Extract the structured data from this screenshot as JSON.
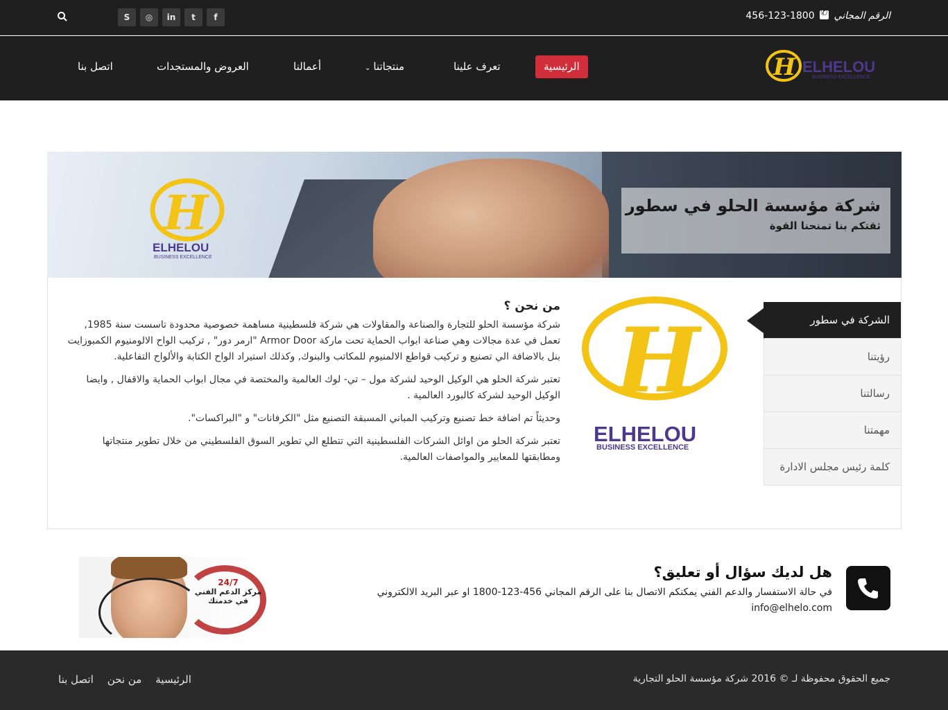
{
  "topbar": {
    "phone_label": "الرقم المجاني",
    "phone_number": "1800-123-456",
    "social_icons": [
      "facebook-icon",
      "twitter-icon",
      "linkedin-icon",
      "dribbble-icon",
      "skype-icon"
    ],
    "social_glyphs": [
      "f",
      "t",
      "in",
      "◎",
      "S"
    ]
  },
  "brand": {
    "name": "ELHELOU",
    "tagline": "BUSINESS EXCELLENCE",
    "logo_gold": "#f3c316",
    "logo_purple": "#4b3a8c"
  },
  "nav": {
    "items": [
      {
        "label": "الرئيسية",
        "active": true
      },
      {
        "label": "تعرف علينا"
      },
      {
        "label": "منتجاتنا",
        "has_dropdown": true
      },
      {
        "label": "أعمالنا"
      },
      {
        "label": "العروض والمستجدات"
      },
      {
        "label": "اتصل بنا"
      }
    ],
    "active_color": "#d12e3b"
  },
  "banner": {
    "title": "شركة مؤسسة الحلو في سطور",
    "subtitle": "ثقتكم بنا تمنحنا القوة"
  },
  "about": {
    "heading": "من نحن ؟",
    "paragraphs": [
      "شركة مؤسسة الحلو للتجارة والصناعة والمقاولات هي شركة فلسطينية مساهمة خصوصية محدودة تاسست سنة 1985, تعمل في عدة مجالات وهي صناعة ابواب الحماية تحت ماركة Armor Door \"ارمر دور\" , تركيب الواح الالومنيوم الكمبوزايت بنل بالاضافة الي تصنيع و تركيب قواطع الالمنيوم للمكاتب والبنوك, وكذلك استيراد الواح الكتابة والألواح التفاعلية.",
      "تعتبر شركة الحلو هي الوكيل الوحيد لشركة مول – تي- لوك العالمية والمختصة في مجال ابواب الحماية والاقفال , وايضا الوكيل الوحيد لشركة كالبورد العالمية .",
      "وحديثاً تم اضافة خط تصنيع وتركيب المباني المسبقة التصنيع مثل \"الكرفانات\" و \"البراكسات\".",
      "تعتبر شركة الحلو من اوائل الشركات الفلسطينية التي تتطلع الي تطوير السوق الفلسطيني من خلال تطوير منتجاتها ومطابقتها للمعايير والمواصفات العالمية."
    ]
  },
  "side_menu": {
    "items": [
      {
        "label": "الشركة في سطور",
        "active": true
      },
      {
        "label": "رؤيتنا"
      },
      {
        "label": "رسالتنا"
      },
      {
        "label": "مهمتنا"
      },
      {
        "label": "كلمة رئيس مجلس الادارة"
      }
    ]
  },
  "cta": {
    "title": "هل لديك سؤال أو تعليق؟",
    "text": "في حالة الاستفسار والدعم الفني يمكنكم الاتصال بنا على الرقم المجاني 456-123-1800 او عبر البريد الالكتروني info@elhelo.com",
    "icon": "phone-icon"
  },
  "support_banner": {
    "badge": "24/7",
    "line1": "مركز الدعم الفني",
    "line2": "في خدمتك"
  },
  "footer": {
    "copyright": "جميع الحقوق محفوظة لـ © 2016 شركة مؤسسة الحلو التجارية",
    "links": [
      "الرئيسية",
      "من نحن",
      "اتصل بنا"
    ]
  }
}
